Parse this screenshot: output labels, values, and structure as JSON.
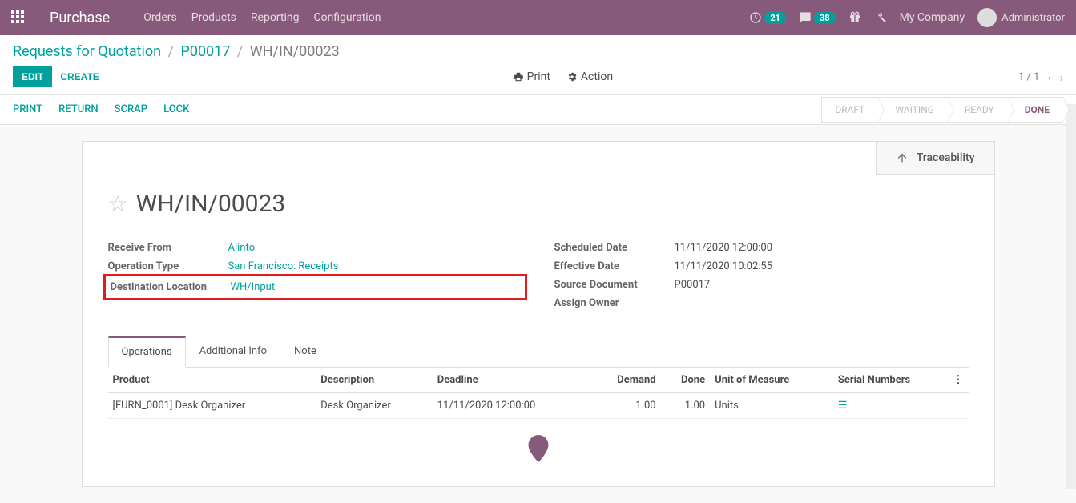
{
  "topbar": {
    "app": "Purchase",
    "menu": [
      "Orders",
      "Products",
      "Reporting",
      "Configuration"
    ],
    "clock_badge": "21",
    "chat_badge": "38",
    "company": "My Company",
    "user": "Administrator"
  },
  "breadcrumb": {
    "root": "Requests for Quotation",
    "po": "P00017",
    "current": "WH/IN/00023"
  },
  "cp": {
    "edit": "Edit",
    "create": "Create",
    "print": "Print",
    "action": "Action",
    "pager": "1 / 1"
  },
  "statusbar": {
    "buttons": [
      "Print",
      "Return",
      "Scrap",
      "Lock"
    ],
    "stages": [
      "Draft",
      "Waiting",
      "Ready",
      "Done"
    ],
    "active_stage": 3
  },
  "buttonbox": {
    "traceability": "Traceability"
  },
  "record": {
    "name": "WH/IN/00023",
    "left": {
      "receive_from_label": "Receive From",
      "receive_from": "Alinto",
      "op_type_label": "Operation Type",
      "op_type": "San Francisco: Receipts",
      "dest_loc_label": "Destination Location",
      "dest_loc": "WH/Input"
    },
    "right": {
      "sched_label": "Scheduled Date",
      "sched": "11/11/2020 12:00:00",
      "eff_label": "Effective Date",
      "eff": "11/11/2020 10:02:55",
      "src_label": "Source Document",
      "src": "P00017",
      "owner_label": "Assign Owner",
      "owner": ""
    }
  },
  "tabs": [
    "Operations",
    "Additional Info",
    "Note"
  ],
  "table": {
    "headers": {
      "product": "Product",
      "description": "Description",
      "deadline": "Deadline",
      "demand": "Demand",
      "done": "Done",
      "uom": "Unit of Measure",
      "serial": "Serial Numbers"
    },
    "rows": [
      {
        "product": "[FURN_0001] Desk Organizer",
        "description": "Desk Organizer",
        "deadline": "11/11/2020 12:00:00",
        "demand": "1.00",
        "done": "1.00",
        "uom": "Units"
      }
    ]
  }
}
